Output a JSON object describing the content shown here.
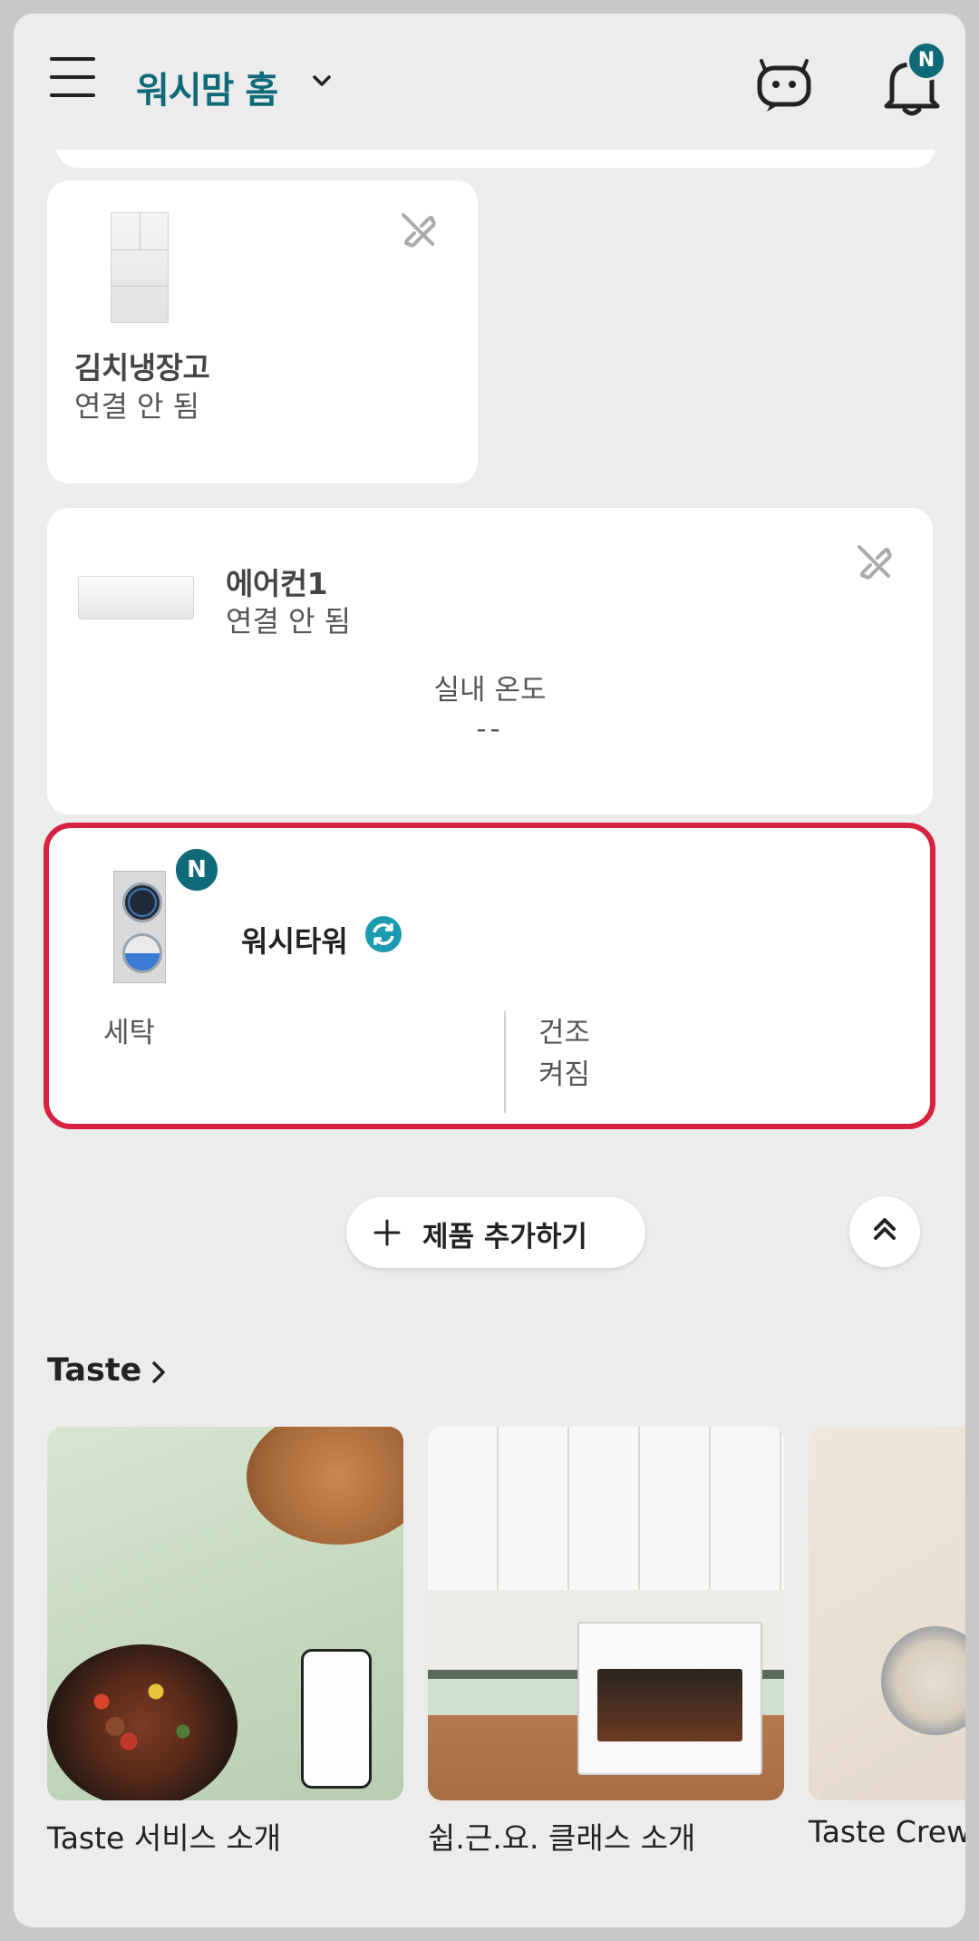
{
  "header": {
    "title": "워시맘 홈",
    "notification_badge": "N",
    "icons": [
      "menu-icon",
      "chevron-down-icon",
      "chatbot-icon",
      "bell-icon"
    ]
  },
  "devices": {
    "kimchi_fridge": {
      "name": "김치냉장고",
      "status": "연결 안 됨"
    },
    "aircon": {
      "name": "에어컨1",
      "status": "연결 안 됨",
      "temp_label": "실내 온도",
      "temp_value": "--"
    },
    "wash_tower": {
      "name": "워시타워",
      "badge": "N",
      "wash_label": "세탁",
      "dry_label": "건조",
      "dry_status": "켜짐",
      "highlight_color": "#d6213f"
    }
  },
  "actions": {
    "add_product": "제품 추가하기"
  },
  "taste": {
    "title": "Taste",
    "cards": [
      {
        "caption": "Taste 서비스 소개"
      },
      {
        "caption": "쉽.근.요. 클래스 소개"
      },
      {
        "caption": "Taste  Crew"
      }
    ]
  },
  "colors": {
    "accent": "#0e6a78",
    "background": "#ececec",
    "highlight": "#d6213f"
  }
}
